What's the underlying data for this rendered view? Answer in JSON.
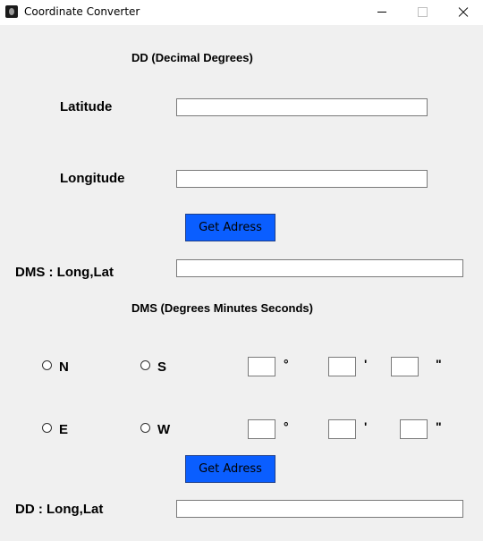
{
  "window": {
    "title": "Coordinate Converter"
  },
  "dd_section": {
    "header": "DD (Decimal Degrees)",
    "latitude_label": "Latitude",
    "latitude_value": "",
    "longitude_label": "Longitude",
    "longitude_value": "",
    "button_label": "Get Adress",
    "result_label": "DMS : Long,Lat",
    "result_value": ""
  },
  "dms_section": {
    "header": "DMS (Degrees Minutes Seconds)",
    "lat_row": {
      "radio_n": "N",
      "radio_s": "S",
      "degrees": "",
      "minutes": "",
      "seconds": ""
    },
    "long_row": {
      "radio_e": "E",
      "radio_w": "W",
      "degrees": "",
      "minutes": "",
      "seconds": ""
    },
    "degree_symbol": "°",
    "minute_symbol": "'",
    "second_symbol": "\"",
    "button_label": "Get Adress",
    "result_label": "DD : Long,Lat",
    "result_value": ""
  },
  "colors": {
    "button": "#0a5eff",
    "background": "#f0f0f0"
  }
}
